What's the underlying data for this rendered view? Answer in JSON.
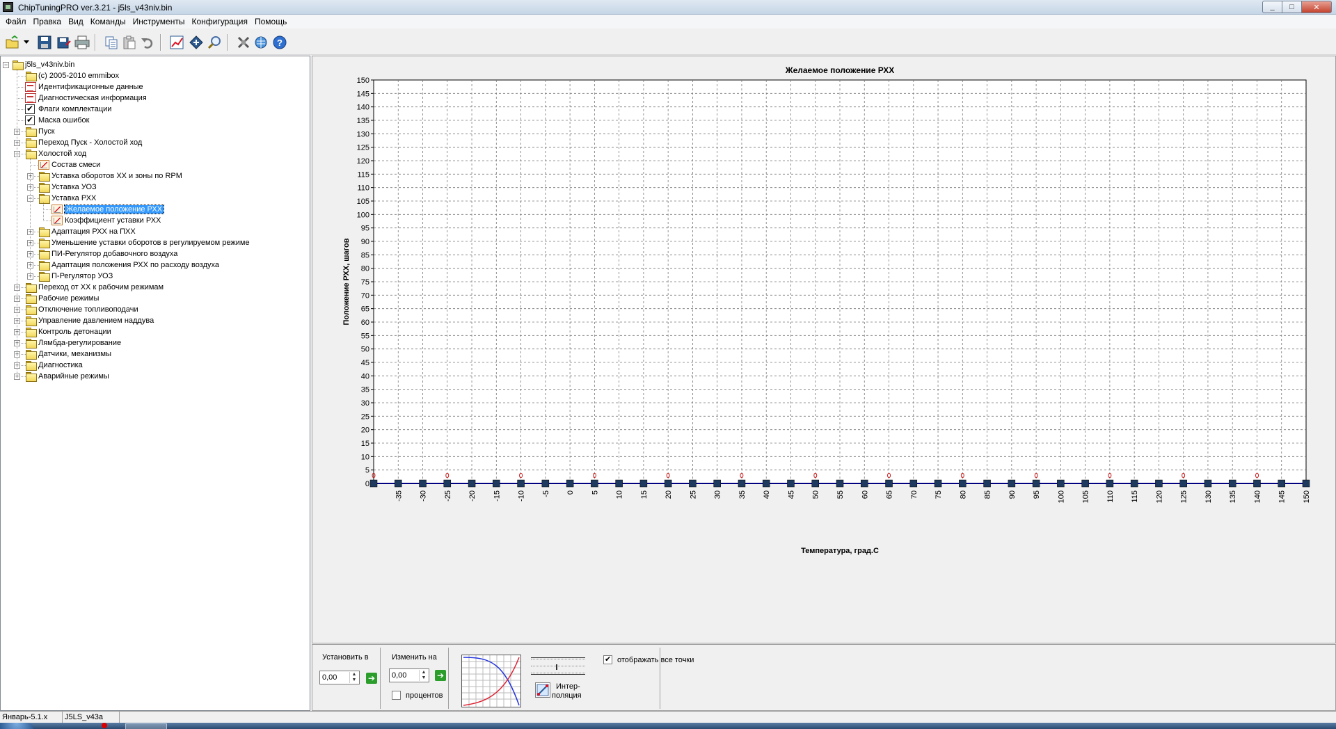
{
  "window": {
    "title": "ChipTuningPRO ver.3.21 - j5ls_v43niv.bin",
    "min": "_",
    "max": "□",
    "close": "✕"
  },
  "menu": [
    "Файл",
    "Правка",
    "Вид",
    "Команды",
    "Инструменты",
    "Конфигурация",
    "Помощь"
  ],
  "toolbar_icons": [
    "open-icon",
    "dropdown-arrow-icon",
    "save-icon",
    "save-as-icon",
    "print-icon",
    "copy-icon",
    "paste-icon",
    "undo-icon",
    "chart-icon",
    "diamond-icon",
    "search-icon",
    "tools-icon",
    "globe-icon",
    "help-icon"
  ],
  "tree": {
    "nodes": [
      {
        "label": "j5ls_v43niv.bin",
        "level": 0,
        "icon": "folder",
        "toggle": "-"
      },
      {
        "label": "(c) 2005-2010 emmibox",
        "level": 1,
        "icon": "folder",
        "toggle": ""
      },
      {
        "label": "Идентификационные данные",
        "level": 1,
        "icon": "doc",
        "toggle": ""
      },
      {
        "label": "Диагностическая информация",
        "level": 1,
        "icon": "doc",
        "toggle": ""
      },
      {
        "label": "Флаги комплектации",
        "level": 1,
        "icon": "check",
        "toggle": ""
      },
      {
        "label": "Маска ошибок",
        "level": 1,
        "icon": "check",
        "toggle": ""
      },
      {
        "label": "Пуск",
        "level": 1,
        "icon": "folder",
        "toggle": "+"
      },
      {
        "label": "Переход Пуск - Холостой ход",
        "level": 1,
        "icon": "folder",
        "toggle": "+"
      },
      {
        "label": "Холостой ход",
        "level": 1,
        "icon": "folder",
        "toggle": "-"
      },
      {
        "label": "Состав смеси",
        "level": 2,
        "icon": "graph",
        "toggle": ""
      },
      {
        "label": "Уставка оборотов ХХ и зоны по RPM",
        "level": 2,
        "icon": "folder",
        "toggle": "+"
      },
      {
        "label": "Уставка УОЗ",
        "level": 2,
        "icon": "folder",
        "toggle": "+"
      },
      {
        "label": "Уставка РХХ",
        "level": 2,
        "icon": "folder",
        "toggle": "-"
      },
      {
        "label": "Желаемое положение РХХ",
        "level": 3,
        "icon": "graph",
        "toggle": "",
        "selected": true
      },
      {
        "label": "Коэффициент уставки РХХ",
        "level": 3,
        "icon": "graph",
        "toggle": ""
      },
      {
        "label": "Адаптация РХХ на ПХХ",
        "level": 2,
        "icon": "folder",
        "toggle": "+"
      },
      {
        "label": "Уменьшение уставки оборотов в регулируемом режиме",
        "level": 2,
        "icon": "folder",
        "toggle": "+"
      },
      {
        "label": "ПИ-Регулятор добавочного воздуха",
        "level": 2,
        "icon": "folder",
        "toggle": "+"
      },
      {
        "label": "Адаптация положения РХХ по расходу воздуха",
        "level": 2,
        "icon": "folder",
        "toggle": "+"
      },
      {
        "label": "П-Регулятор УОЗ",
        "level": 2,
        "icon": "folder",
        "toggle": "+"
      },
      {
        "label": "Переход от ХХ к рабочим режимам",
        "level": 1,
        "icon": "folder",
        "toggle": "+"
      },
      {
        "label": "Рабочие режимы",
        "level": 1,
        "icon": "folder",
        "toggle": "+"
      },
      {
        "label": "Отключение топливоподачи",
        "level": 1,
        "icon": "folder",
        "toggle": "+"
      },
      {
        "label": "Управление давлением наддува",
        "level": 1,
        "icon": "folder",
        "toggle": "+"
      },
      {
        "label": "Контроль детонации",
        "level": 1,
        "icon": "folder",
        "toggle": "+"
      },
      {
        "label": "Лямбда-регулирование",
        "level": 1,
        "icon": "folder",
        "toggle": "+"
      },
      {
        "label": "Датчики, механизмы",
        "level": 1,
        "icon": "folder",
        "toggle": "+"
      },
      {
        "label": "Диагностика",
        "level": 1,
        "icon": "folder",
        "toggle": "+"
      },
      {
        "label": "Аварийные режимы",
        "level": 1,
        "icon": "folder",
        "toggle": "+"
      }
    ]
  },
  "chart_data": {
    "type": "line",
    "title": "Желаемое положение РХХ",
    "xlabel": "Температура, град.С",
    "ylabel": "Положение РХХ, шагов",
    "x": [
      -40,
      -35,
      -30,
      -25,
      -20,
      -15,
      -10,
      -5,
      0,
      5,
      10,
      15,
      20,
      25,
      30,
      35,
      40,
      45,
      50,
      55,
      60,
      65,
      70,
      75,
      80,
      85,
      90,
      95,
      100,
      105,
      110,
      115,
      120,
      125,
      130,
      135,
      140,
      145,
      150
    ],
    "values": [
      0,
      0,
      0,
      0,
      0,
      0,
      0,
      0,
      0,
      0,
      0,
      0,
      0,
      0,
      0,
      0,
      0,
      0,
      0,
      0,
      0,
      0,
      0,
      0,
      0,
      0,
      0,
      0,
      0,
      0,
      0,
      0,
      0,
      0,
      0,
      0,
      0,
      0,
      0
    ],
    "xlim": [
      -40,
      150
    ],
    "ylim": [
      0,
      150
    ],
    "ytick_step": 5,
    "xtick_labels_shown": [
      "-35",
      "-30",
      "-25",
      "-20",
      "-15",
      "-10",
      "-5",
      "0",
      "5",
      "10",
      "15",
      "20",
      "25",
      "30",
      "35",
      "40",
      "45",
      "50",
      "55",
      "60",
      "65",
      "70",
      "75",
      "80",
      "85",
      "90",
      "95",
      "100",
      "105",
      "110",
      "115",
      "120",
      "125",
      "130",
      "135",
      "140",
      "145",
      "150"
    ],
    "data_labels_every_other_point": "0",
    "grid": true,
    "line_color": "#000080",
    "marker_color": "#1f3a5f",
    "label_color": "#cc0000"
  },
  "controls": {
    "set_to": {
      "label": "Установить в",
      "value": "0,00"
    },
    "change_by": {
      "label": "Изменить на",
      "value": "0,00",
      "percent_label": "процентов",
      "percent_checked": false
    },
    "interp_label_1": "Интер-",
    "interp_label_2": "поляция",
    "show_all_points": {
      "label": "отображать все точки",
      "checked": true
    }
  },
  "status": [
    "Январь-5.1.x",
    "J5LS_v43a"
  ]
}
